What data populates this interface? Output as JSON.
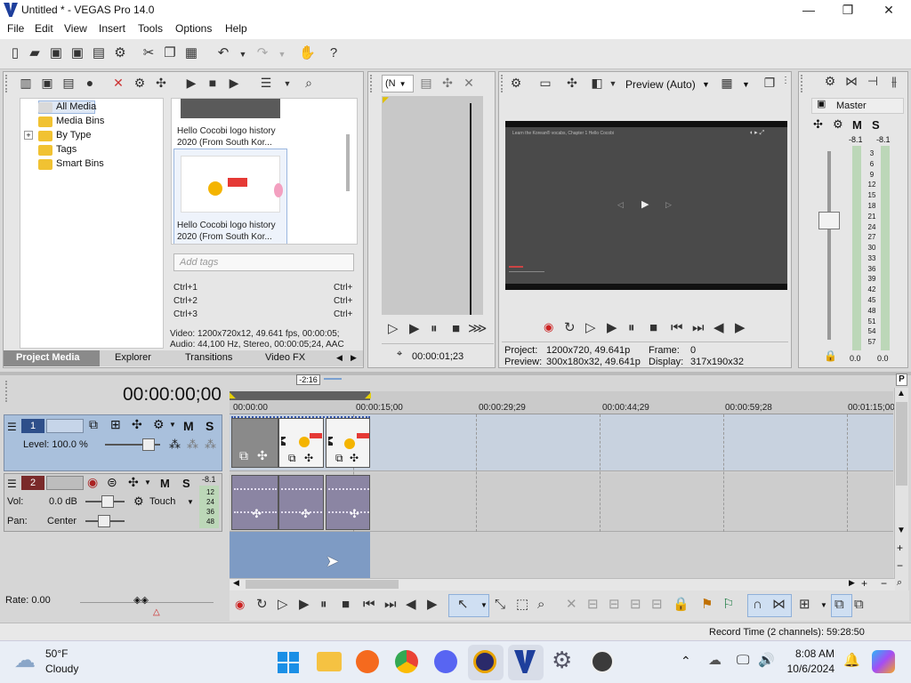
{
  "window": {
    "title": "Untitled * - VEGAS Pro 14.0",
    "minimize": "—",
    "maximize": "❐",
    "close": "✕"
  },
  "menu": [
    "File",
    "Edit",
    "View",
    "Insert",
    "Tools",
    "Options",
    "Help"
  ],
  "explorer": {
    "tree": [
      "All Media",
      "Media Bins",
      "By Type",
      "Tags",
      "Smart Bins"
    ],
    "expand_glyph": "+",
    "media": [
      {
        "caption_line1": "Hello Cocobi logo history",
        "caption_line2": "2020 (From South Kor..."
      },
      {
        "caption_line1": "Hello Cocobi logo history",
        "caption_line2": "2020 (From South Kor..."
      }
    ],
    "tag_placeholder": "Add tags",
    "shortcuts": [
      {
        "key": "Ctrl+1",
        "right": "Ctrl+"
      },
      {
        "key": "Ctrl+2",
        "right": "Ctrl+"
      },
      {
        "key": "Ctrl+3",
        "right": "Ctrl+"
      }
    ],
    "info_video": "Video: 1200x720x12, 49.641 fps, 00:00:05;",
    "info_audio": "Audio: 44,100 Hz, Stereo, 00:00:05;24, AAC",
    "tabs": [
      "Project Media",
      "Explorer",
      "Transitions",
      "Video FX"
    ],
    "active_tab": "Project Media"
  },
  "trimmer": {
    "dropdown": "(N",
    "timecode": "00:00:01;23"
  },
  "preview": {
    "mode": "Preview (Auto)",
    "project_label": "Project:",
    "project_value": "1200x720, 49.641p",
    "frame_label": "Frame:",
    "frame_value": "0",
    "preview_label": "Preview:",
    "preview_value": "300x180x32, 49.641p",
    "display_label": "Display:",
    "display_value": "317x190x32",
    "video_text": "Learn the Korean® vocabs, Chapter 1 Hello Cocobi"
  },
  "master": {
    "title": "Master",
    "m": "M",
    "s": "S",
    "peak_left": "-8.1",
    "peak_right": "-8.1",
    "scale": [
      "3",
      "6",
      "9",
      "12",
      "15",
      "18",
      "21",
      "24",
      "27",
      "30",
      "33",
      "36",
      "39",
      "42",
      "45",
      "48",
      "51",
      "54",
      "57"
    ],
    "readout_left": "0.0",
    "readout_right": "0.0"
  },
  "timeline": {
    "cursor_time": "00:00:00;00",
    "marker_badge": "-2:16",
    "ruler": [
      "00:00:00",
      "00:00:15;00",
      "00:00:29;29",
      "00:00:44;29",
      "00:00:59;28",
      "00:01:15;00"
    ],
    "video_track": {
      "number": "1",
      "level": "Level: 100.0 %",
      "m": "M",
      "s": "S"
    },
    "audio_track": {
      "number": "2",
      "vol_label": "Vol:",
      "vol_value": "0.0 dB",
      "pan_label": "Pan:",
      "pan_value": "Center",
      "automation": "Touch",
      "m": "M",
      "s": "S",
      "meter_peak": "-8.1",
      "meter_scale": [
        "12",
        "24",
        "36",
        "48"
      ]
    },
    "rate": "Rate: 0.00",
    "record_time": "Record Time (2 channels): 59:28:50",
    "help_glyph": "P"
  },
  "taskbar": {
    "weather_temp": "50°F",
    "weather_desc": "Cloudy",
    "time": "8:08 AM",
    "date": "10/6/2024"
  },
  "colors": {
    "video_track": "#a9c0dc",
    "audio_clip": "#8b85a3",
    "selection": "#7e9bc4",
    "record": "#cc2222"
  }
}
